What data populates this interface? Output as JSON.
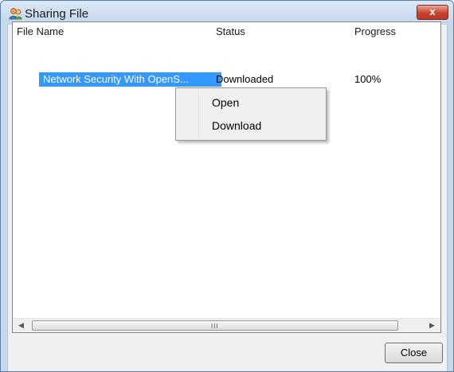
{
  "window": {
    "title": "Sharing File",
    "close_glyph": "x",
    "icon": "users-icon"
  },
  "listview": {
    "columns": [
      "File Name",
      "Status",
      "Progress"
    ],
    "rows": [
      {
        "file_name": "Network Security With OpenS...",
        "status": "Downloaded",
        "progress": "100%"
      }
    ],
    "scrollbar_grip": "III"
  },
  "context_menu": {
    "items": [
      "Open",
      "Download"
    ]
  },
  "footer": {
    "close_label": "Close"
  }
}
